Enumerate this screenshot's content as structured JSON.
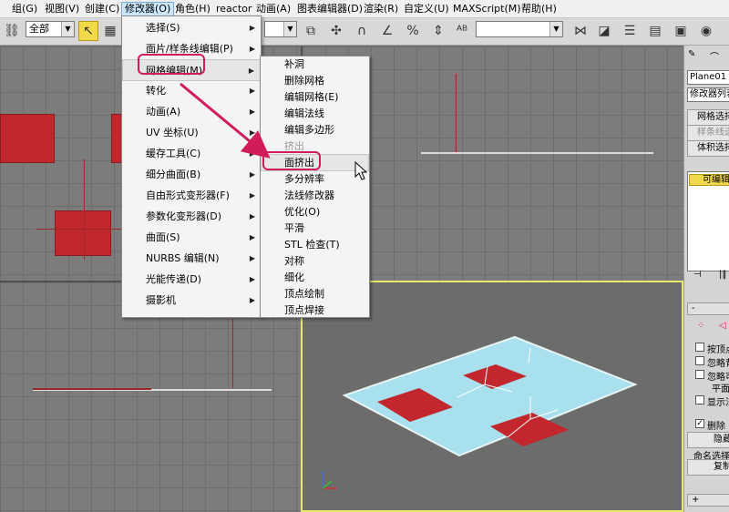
{
  "menubar": {
    "items": [
      "组(G)",
      "视图(V)",
      "创建(C)",
      "修改器(O)",
      "角色(H)",
      "reactor",
      "动画(A)",
      "图表编辑器(D)",
      "渲染(R)",
      "自定义(U)",
      "MAXScript(M)",
      "帮助(H)"
    ]
  },
  "toolbar": {
    "selection_filter": "全部"
  },
  "modifiers_menu": {
    "items": [
      {
        "label": "选择(S)",
        "submenu": true
      },
      {
        "label": "面片/样条线编辑(P)",
        "submenu": true
      },
      {
        "label": "网格编辑(M)",
        "submenu": true
      },
      {
        "label": "转化",
        "submenu": true
      },
      {
        "label": "动画(A)",
        "submenu": true
      },
      {
        "label": "UV 坐标(U)",
        "submenu": true
      },
      {
        "label": "缓存工具(C)",
        "submenu": true
      },
      {
        "label": "细分曲面(B)",
        "submenu": true
      },
      {
        "label": "自由形式变形器(F)",
        "submenu": true
      },
      {
        "label": "参数化变形器(D)",
        "submenu": true
      },
      {
        "label": "曲面(S)",
        "submenu": true
      },
      {
        "label": "NURBS 编辑(N)",
        "submenu": true
      },
      {
        "label": "光能传递(D)",
        "submenu": true
      },
      {
        "label": "摄影机",
        "submenu": true
      }
    ]
  },
  "mesh_edit_submenu": {
    "items": [
      {
        "label": "补洞",
        "disabled": false
      },
      {
        "label": "删除网格",
        "disabled": false
      },
      {
        "label": "编辑网格(E)",
        "disabled": false
      },
      {
        "label": "编辑法线",
        "disabled": false
      },
      {
        "label": "编辑多边形",
        "disabled": false
      },
      {
        "label": "挤出",
        "disabled": true
      },
      {
        "label": "面挤出",
        "disabled": false
      },
      {
        "label": "多分辨率",
        "disabled": false
      },
      {
        "label": "法线修改器",
        "disabled": false
      },
      {
        "label": "优化(O)",
        "disabled": false
      },
      {
        "label": "平滑",
        "disabled": false
      },
      {
        "label": "STL 检查(T)",
        "disabled": false
      },
      {
        "label": "对称",
        "disabled": false
      },
      {
        "label": "细化",
        "disabled": false
      },
      {
        "label": "顶点绘制",
        "disabled": false
      },
      {
        "label": "顶点焊接",
        "disabled": false
      }
    ]
  },
  "command_panel": {
    "object_name": "Plane01",
    "modifier_list": "修改器列表",
    "buttons": [
      "网格选择",
      "样条线选择",
      "体积选择"
    ],
    "stack_item": "可编辑",
    "checkboxes": [
      "按顶点",
      "忽略背",
      "忽略可"
    ],
    "plane_label": "平面",
    "show_label": "显示法",
    "delete_label": "删除",
    "hide_button": "隐藏",
    "named_selection": "命名选择",
    "copy_button": "复制"
  },
  "colors": {
    "accent_highlight": "#d21c5a",
    "viewport_active_border": "#e8e86a",
    "plane_color": "#a8e0ee",
    "selected_face_color": "#c1272d"
  }
}
